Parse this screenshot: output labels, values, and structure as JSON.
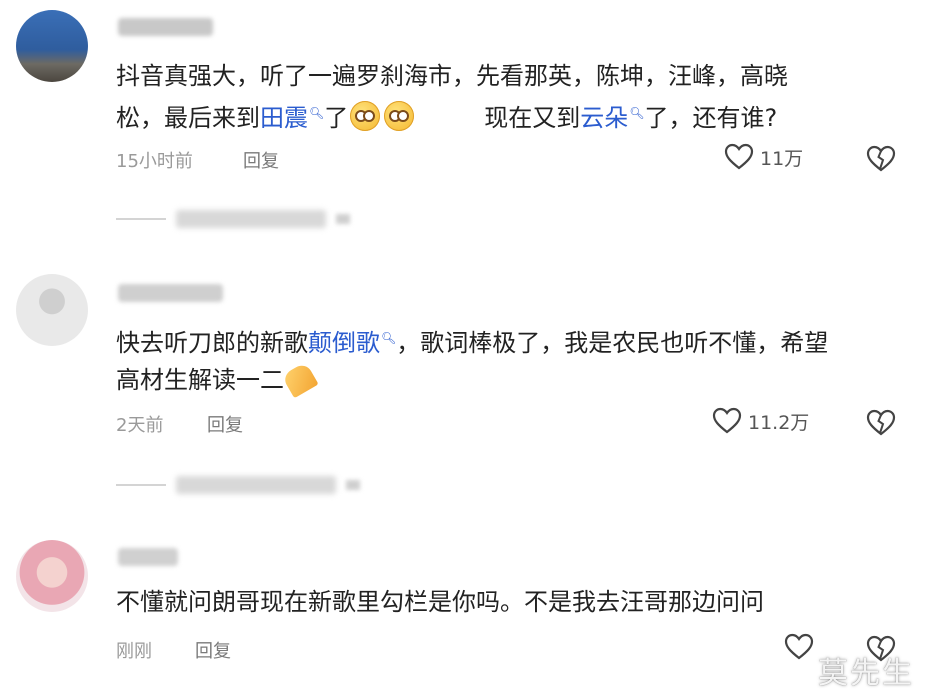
{
  "comments": [
    {
      "text_line1": "抖音真强大，听了一遍罗刹海市，先看那英，陈坤，汪峰，高晓",
      "text_line2_a": "松，最后来到",
      "text_line2_link1": "田震",
      "text_line2_b": "了",
      "text_line2_c": "现在又到",
      "text_line2_link2": "云朵",
      "text_line2_d": "了，还有谁?",
      "time": "15小时前",
      "reply": "回复",
      "likes": "11万"
    },
    {
      "text_line1_a": "快去听刀郎的新歌",
      "text_line1_link": "颠倒歌",
      "text_line1_b": "，歌词棒极了，我是农民也听不懂，希望",
      "text_line2": "高材生解读一二",
      "time": "2天前",
      "reply": "回复",
      "likes": "11.2万"
    },
    {
      "text_line1": "不懂就问朗哥现在新歌里勾栏是你吗。不是我去汪哥那边问问",
      "time": "刚刚",
      "reply": "回复"
    }
  ],
  "icons": {
    "search_link": "search-icon",
    "like": "heart-outline-icon",
    "dislike": "broken-heart-icon",
    "emoji_smile": "smiling-face-emoji",
    "emoji_hands": "folded-hands-emoji"
  },
  "colors": {
    "link": "#2b5ccf",
    "meta": "#9a9a9a",
    "text": "#222222"
  },
  "watermark": "莫先生"
}
